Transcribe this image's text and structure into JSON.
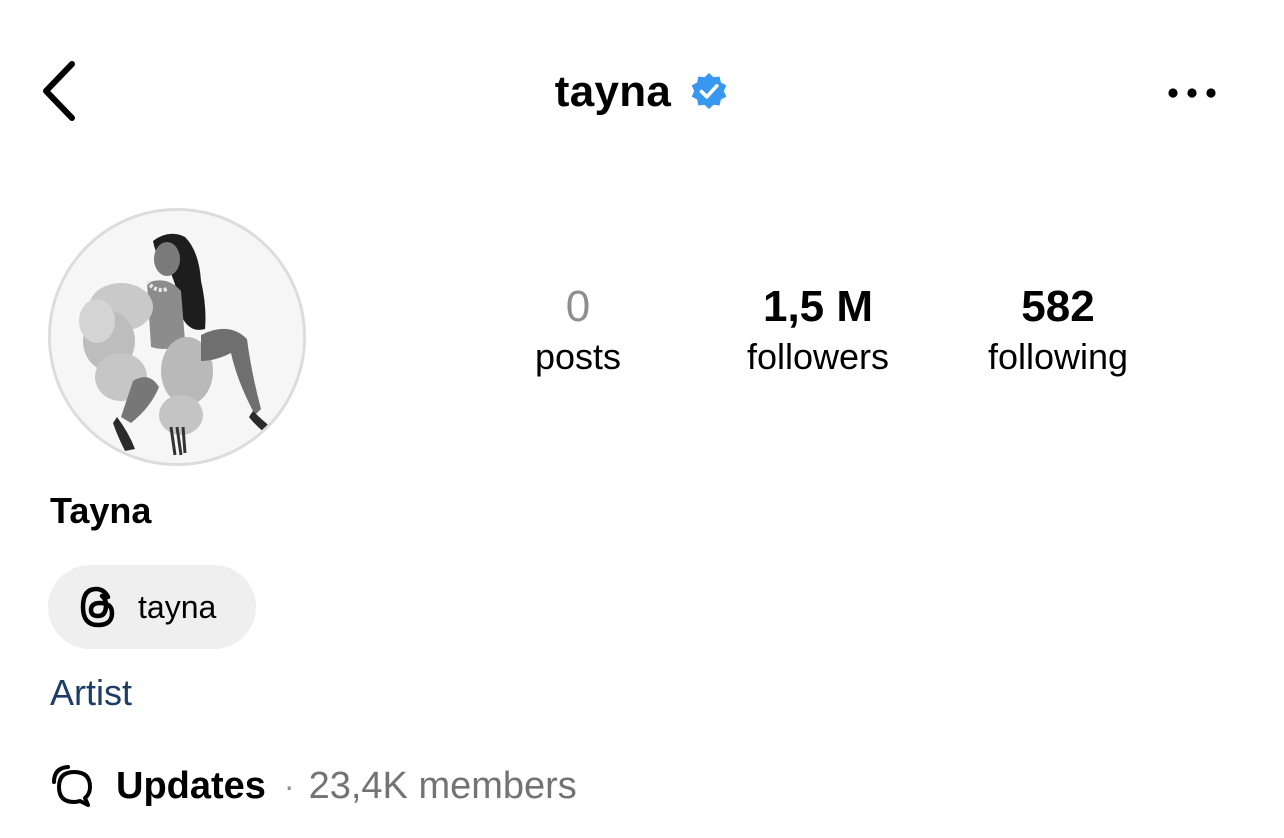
{
  "header": {
    "username": "tayna",
    "verified": true,
    "back_icon": "chevron-left-icon",
    "more_icon": "more-horizontal-icon",
    "verified_color": "#3897f0"
  },
  "profile": {
    "display_name": "Tayna",
    "stats": {
      "posts": {
        "value": "0",
        "label": "posts"
      },
      "followers": {
        "value": "1,5 M",
        "label": "followers"
      },
      "following": {
        "value": "582",
        "label": "following"
      }
    },
    "threads": {
      "icon": "threads-icon",
      "handle": "tayna"
    },
    "category": "Artist",
    "channel": {
      "icon": "broadcast-channel-icon",
      "name": "Updates",
      "separator": "·",
      "members": "23,4K members"
    }
  }
}
